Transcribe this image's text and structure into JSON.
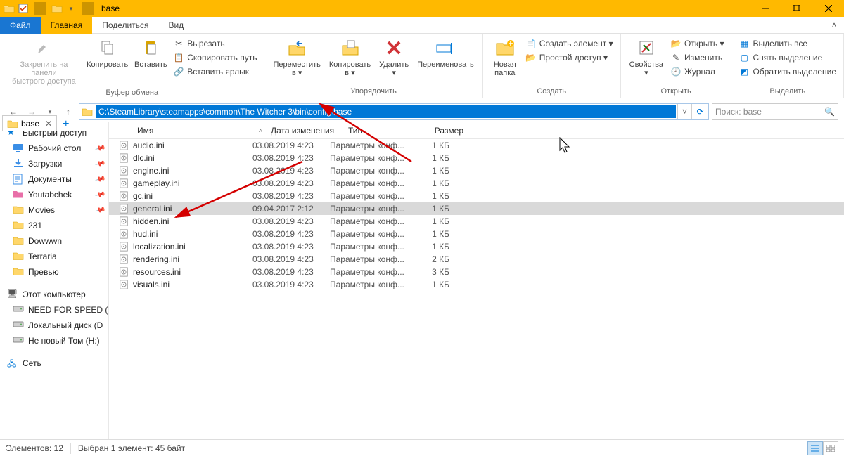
{
  "window": {
    "title": "base"
  },
  "tabs": {
    "file": "Файл",
    "main": "Главная",
    "share": "Поделиться",
    "view": "Вид"
  },
  "ribbon": {
    "clipboard": {
      "pin": "Закрепить на панели\nбыстрого доступа",
      "copy": "Копировать",
      "paste": "Вставить",
      "cut": "Вырезать",
      "copypath": "Скопировать путь",
      "shortcut": "Вставить ярлык",
      "label": "Буфер обмена"
    },
    "organize": {
      "moveto": "Переместить\nв ▾",
      "copyto": "Копировать\nв ▾",
      "delete": "Удалить\n▾",
      "rename": "Переименовать",
      "label": "Упорядочить"
    },
    "new": {
      "newfolder": "Новая\nпапка",
      "newitem": "Создать элемент ▾",
      "easy": "Простой доступ ▾",
      "label": "Создать"
    },
    "open": {
      "props": "Свойства\n▾",
      "open": "Открыть ▾",
      "edit": "Изменить",
      "history": "Журнал",
      "label": "Открыть"
    },
    "select": {
      "all": "Выделить все",
      "none": "Снять выделение",
      "invert": "Обратить выделение",
      "label": "Выделить"
    }
  },
  "address": {
    "path": "C:\\SteamLibrary\\steamapps\\common\\The Witcher 3\\bin\\config\\base"
  },
  "search": {
    "placeholder": "Поиск: base"
  },
  "foldertab": {
    "name": "base"
  },
  "navtree": {
    "quick": "Быстрый доступ",
    "items": [
      {
        "label": "Рабочий стол",
        "icon": "desktop",
        "pinned": true
      },
      {
        "label": "Загрузки",
        "icon": "downloads",
        "pinned": true
      },
      {
        "label": "Документы",
        "icon": "documents",
        "pinned": true
      },
      {
        "label": "Youtabchek",
        "icon": "folder-pink",
        "pinned": true
      },
      {
        "label": "Movies",
        "icon": "folder",
        "pinned": true
      },
      {
        "label": "231",
        "icon": "folder",
        "pinned": false
      },
      {
        "label": "Dowwwn",
        "icon": "folder",
        "pinned": false
      },
      {
        "label": "Terraria",
        "icon": "folder",
        "pinned": false
      },
      {
        "label": "Превью",
        "icon": "folder",
        "pinned": false
      }
    ],
    "thispc": "Этот компьютер",
    "drives": [
      {
        "label": "NEED FOR SPEED (G"
      },
      {
        "label": "Локальный диск (D"
      },
      {
        "label": "Не новый Том (H:)"
      }
    ],
    "network": "Сеть"
  },
  "columns": {
    "name": "Имя",
    "date": "Дата изменения",
    "type": "Тип",
    "size": "Размер"
  },
  "files": [
    {
      "name": "audio.ini",
      "date": "03.08.2019 4:23",
      "type": "Параметры конф...",
      "size": "1 КБ",
      "sel": false
    },
    {
      "name": "dlc.ini",
      "date": "03.08.2019 4:23",
      "type": "Параметры конф...",
      "size": "1 КБ",
      "sel": false
    },
    {
      "name": "engine.ini",
      "date": "03.08.2019 4:23",
      "type": "Параметры конф...",
      "size": "1 КБ",
      "sel": false
    },
    {
      "name": "gameplay.ini",
      "date": "03.08.2019 4:23",
      "type": "Параметры конф...",
      "size": "1 КБ",
      "sel": false
    },
    {
      "name": "gc.ini",
      "date": "03.08.2019 4:23",
      "type": "Параметры конф...",
      "size": "1 КБ",
      "sel": false
    },
    {
      "name": "general.ini",
      "date": "09.04.2017 2:12",
      "type": "Параметры конф...",
      "size": "1 КБ",
      "sel": true
    },
    {
      "name": "hidden.ini",
      "date": "03.08.2019 4:23",
      "type": "Параметры конф...",
      "size": "1 КБ",
      "sel": false
    },
    {
      "name": "hud.ini",
      "date": "03.08.2019 4:23",
      "type": "Параметры конф...",
      "size": "1 КБ",
      "sel": false
    },
    {
      "name": "localization.ini",
      "date": "03.08.2019 4:23",
      "type": "Параметры конф...",
      "size": "1 КБ",
      "sel": false
    },
    {
      "name": "rendering.ini",
      "date": "03.08.2019 4:23",
      "type": "Параметры конф...",
      "size": "2 КБ",
      "sel": false
    },
    {
      "name": "resources.ini",
      "date": "03.08.2019 4:23",
      "type": "Параметры конф...",
      "size": "3 КБ",
      "sel": false
    },
    {
      "name": "visuals.ini",
      "date": "03.08.2019 4:23",
      "type": "Параметры конф...",
      "size": "1 КБ",
      "sel": false
    }
  ],
  "status": {
    "count": "Элементов: 12",
    "selected": "Выбран 1 элемент: 45 байт"
  }
}
